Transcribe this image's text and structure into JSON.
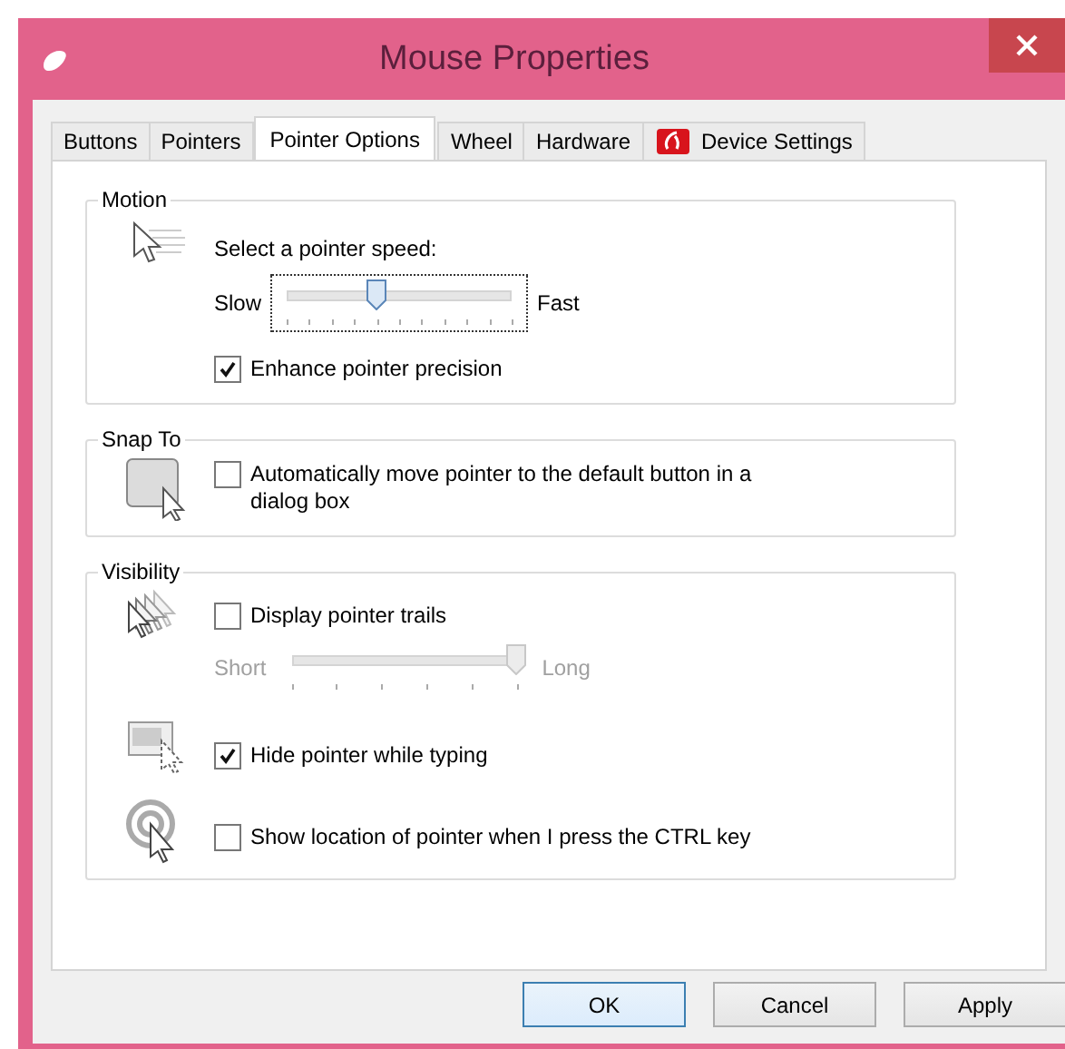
{
  "window": {
    "title": "Mouse Properties"
  },
  "tabs": [
    {
      "label": "Buttons",
      "selected": false,
      "kind": "plain"
    },
    {
      "label": "Pointers",
      "selected": false,
      "kind": "plain"
    },
    {
      "label": "Pointer Options",
      "selected": true,
      "kind": "plain"
    },
    {
      "label": "Wheel",
      "selected": false,
      "kind": "plain"
    },
    {
      "label": "Hardware",
      "selected": false,
      "kind": "plain"
    },
    {
      "label": "Device Settings",
      "selected": false,
      "kind": "device"
    }
  ],
  "groups": [
    {
      "title": "Motion",
      "rows": [
        {
          "kind": "label",
          "text": "Select a pointer speed:"
        },
        {
          "kind": "slider",
          "min_label": "Slow",
          "max_label": "Fast",
          "level": 0.4,
          "focused": true,
          "disabled": false
        },
        {
          "kind": "checkbox",
          "label": "Enhance pointer precision",
          "checked": true
        }
      ]
    },
    {
      "title": "Snap To",
      "rows": [
        {
          "kind": "checkbox",
          "label": "Automatically move pointer to the default button in a dialog box",
          "checked": false
        }
      ]
    },
    {
      "title": "Visibility",
      "rows": [
        {
          "kind": "checkbox",
          "label": "Display pointer trails",
          "checked": false
        },
        {
          "kind": "slider",
          "min_label": "Short",
          "max_label": "Long",
          "level": 1,
          "focused": false,
          "disabled": true
        },
        {
          "kind": "checkbox",
          "label": "Hide pointer while typing",
          "checked": true
        },
        {
          "kind": "checkbox",
          "label": "Show location of pointer when I press the CTRL key",
          "checked": false
        }
      ]
    }
  ],
  "buttons": [
    {
      "label": "OK",
      "default": true
    },
    {
      "label": "Cancel",
      "default": false
    },
    {
      "label": "Apply",
      "default": false
    }
  ]
}
